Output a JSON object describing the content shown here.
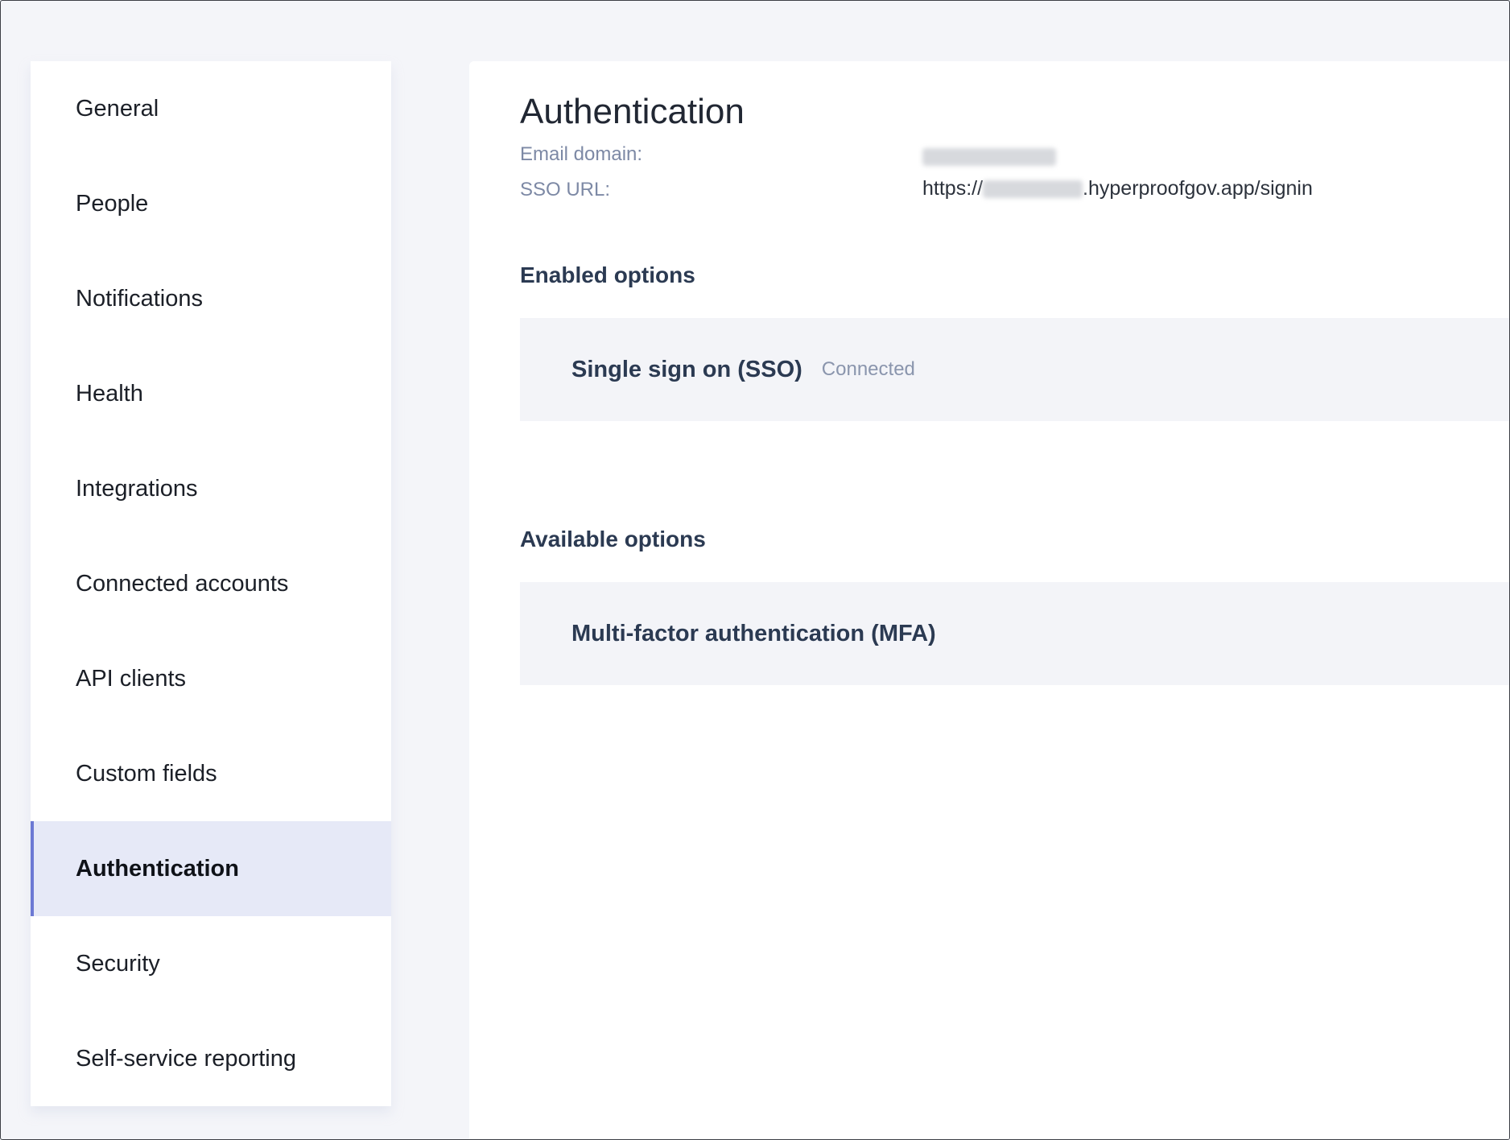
{
  "sidebar": {
    "items": [
      {
        "label": "General"
      },
      {
        "label": "People"
      },
      {
        "label": "Notifications"
      },
      {
        "label": "Health"
      },
      {
        "label": "Integrations"
      },
      {
        "label": "Connected accounts"
      },
      {
        "label": "API clients"
      },
      {
        "label": "Custom fields"
      },
      {
        "label": "Authentication",
        "active": true
      },
      {
        "label": "Security"
      },
      {
        "label": "Self-service reporting"
      }
    ]
  },
  "main": {
    "title": "Authentication",
    "email_domain": {
      "label": "Email domain:",
      "value": ""
    },
    "sso_url": {
      "label": "SSO URL:",
      "prefix": "https://",
      "suffix": ".hyperproofgov.app/signin"
    },
    "enabled": {
      "heading": "Enabled options",
      "options": [
        {
          "title": "Single sign on (SSO)",
          "status": "Connected"
        }
      ]
    },
    "available": {
      "heading": "Available options",
      "options": [
        {
          "title": "Multi-factor authentication (MFA)"
        }
      ]
    }
  },
  "colors": {
    "accent": "#6c79d4",
    "active_bg": "#e6e9f7",
    "card_bg": "#f3f4f8",
    "page_bg": "#f4f5f9"
  }
}
